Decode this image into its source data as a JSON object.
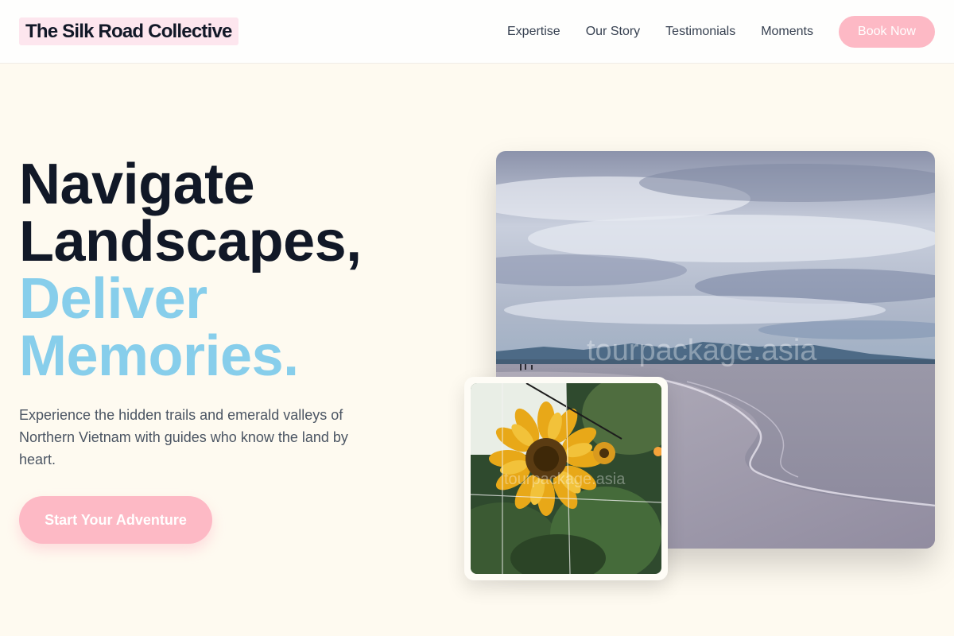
{
  "header": {
    "logo": "The Silk Road Collective",
    "nav": [
      "Expertise",
      "Our Story",
      "Testimonials",
      "Moments"
    ],
    "book_label": "Book Now"
  },
  "hero": {
    "title_line1": "Navigate",
    "title_line2": "Landscapes,",
    "title_line3": "Deliver",
    "title_line4": "Memories.",
    "subtitle": "Experience the hidden trails and emerald valleys of Northern Vietnam with guides who know the land by heart.",
    "cta_label": "Start Your Adventure"
  },
  "images": {
    "main_watermark": "tourpackage.asia",
    "small_watermark": "tourpackage.asia"
  },
  "colors": {
    "background": "#fefaf0",
    "accent_pink": "#fdb9c5",
    "accent_sky": "#87ceeb",
    "heading": "#111827"
  }
}
